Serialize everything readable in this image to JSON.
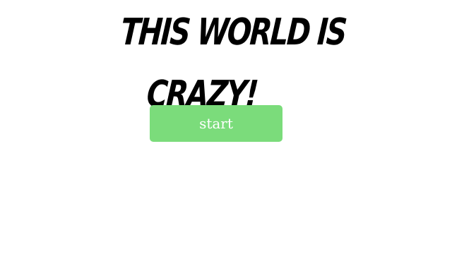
{
  "title": {
    "line1": "THIS WORLD IS",
    "line2": "CRAZY!"
  },
  "start_button": {
    "label": "start"
  },
  "colors": {
    "background": "#ffffff",
    "title_text": "#000000",
    "button_fill": "#7bdc7b",
    "button_text": "#ffffff"
  }
}
